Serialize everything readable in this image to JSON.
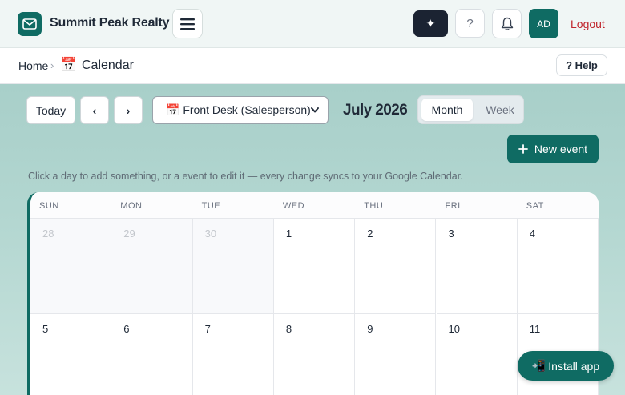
{
  "header": {
    "brand": "Summit Peak Realty",
    "avatar_initials": "AD",
    "logout_label": "Logout",
    "help_icon_text": "?",
    "spark_icon_text": "✦"
  },
  "breadcrumb": {
    "home": "Home",
    "separator": "›",
    "current_icon": "📅",
    "current": "Calendar",
    "help_label": "? Help"
  },
  "toolbar": {
    "today_label": "Today",
    "prev_label": "‹",
    "next_label": "›",
    "calendar_select": "📅 Front Desk (Salesperson)",
    "month_title": "July 2026",
    "view_month": "Month",
    "view_week": "Week",
    "new_event_label": "New event",
    "hint": "Click a day to add something, or a event to edit it — every change syncs to your Google Calendar."
  },
  "calendar": {
    "weekdays": [
      "SUN",
      "MON",
      "TUE",
      "WED",
      "THU",
      "FRI",
      "SAT"
    ],
    "weeks": [
      [
        {
          "day": "28",
          "other": true
        },
        {
          "day": "29",
          "other": true
        },
        {
          "day": "30",
          "other": true
        },
        {
          "day": "1",
          "other": false
        },
        {
          "day": "2",
          "other": false
        },
        {
          "day": "3",
          "other": false
        },
        {
          "day": "4",
          "other": false
        }
      ],
      [
        {
          "day": "5",
          "other": false
        },
        {
          "day": "6",
          "other": false
        },
        {
          "day": "7",
          "other": false
        },
        {
          "day": "8",
          "other": false
        },
        {
          "day": "9",
          "other": false
        },
        {
          "day": "10",
          "other": false
        },
        {
          "day": "11",
          "other": false
        }
      ]
    ]
  },
  "install": {
    "icon": "📲",
    "label": "Install app"
  },
  "colors": {
    "brand": "#0f6b63",
    "logout": "#c0262d",
    "dark_button": "#1b2332"
  }
}
